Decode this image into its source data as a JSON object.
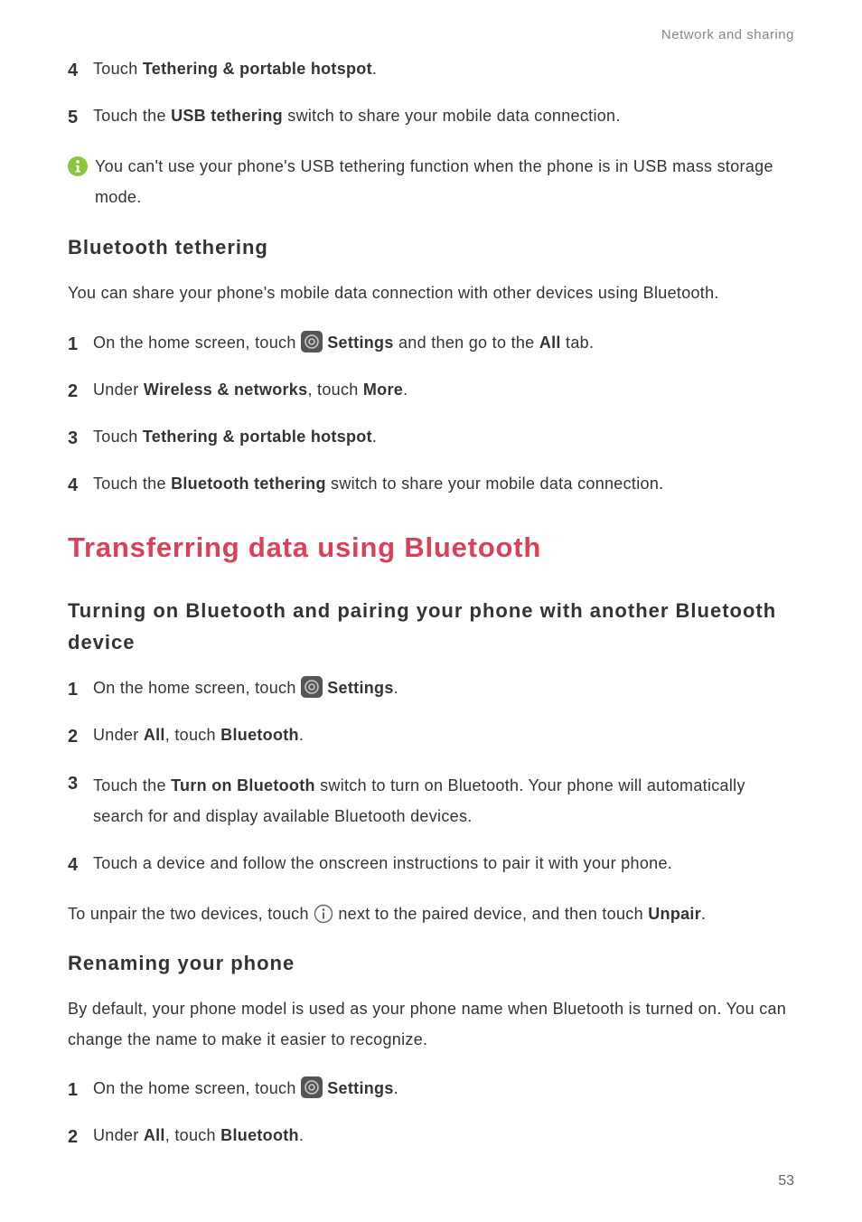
{
  "header": {
    "section": "Network and sharing"
  },
  "usb_steps": {
    "s4": {
      "pre": "Touch ",
      "bold": "Tethering & portable hotspot",
      "post": "."
    },
    "s5": {
      "pre": "Touch the ",
      "bold": "USB tethering",
      "post": " switch to share your mobile data connection."
    }
  },
  "info_note": "You can't use your phone's USB tethering function when the phone is in USB mass storage mode.",
  "bt_tether": {
    "title": "Bluetooth tethering",
    "intro": "You can share your phone's mobile data connection with other devices using Bluetooth.",
    "s1_pre": "On the home screen, touch ",
    "s1_settings": "Settings",
    "s1_mid": " and then go to the ",
    "s1_all": "All",
    "s1_post": " tab.",
    "s2_pre": "Under ",
    "s2_wifi": "Wireless & networks",
    "s2_mid": ", touch ",
    "s2_more": "More",
    "s2_post": ".",
    "s3_pre": "Touch ",
    "s3_bold": "Tethering & portable hotspot",
    "s3_post": ".",
    "s4_pre": "Touch the ",
    "s4_bold": "Bluetooth tethering",
    "s4_post": " switch to share your mobile data connection."
  },
  "transfer_bt": {
    "title": "Transferring data using Bluetooth"
  },
  "pairing": {
    "title": "Turning on Bluetooth and pairing your phone with another Bluetooth device",
    "s1_pre": "On the home screen, touch ",
    "s1_settings": "Settings",
    "s1_post": ".",
    "s2_pre": "Under ",
    "s2_all": "All",
    "s2_mid": ", touch ",
    "s2_bt": "Bluetooth",
    "s2_post": ".",
    "s3_pre": "Touch the ",
    "s3_bold": "Turn on Bluetooth",
    "s3_post": " switch to turn on Bluetooth. Your phone will automatically search for and display available Bluetooth devices.",
    "s4": "Touch a device and follow the onscreen instructions to pair it with your phone.",
    "unpair_pre": "To unpair the two devices, touch ",
    "unpair_mid": " next to the paired device, and then touch ",
    "unpair_bold": "Unpair",
    "unpair_post": "."
  },
  "rename": {
    "title": "Renaming your phone",
    "intro": "By default, your phone model is used as your phone name when Bluetooth is turned on. You can change the name to make it easier to recognize.",
    "s1_pre": "On the home screen, touch ",
    "s1_settings": "Settings",
    "s1_post": ".",
    "s2_pre": "Under ",
    "s2_all": "All",
    "s2_mid": ", touch ",
    "s2_bt": "Bluetooth",
    "s2_post": "."
  },
  "page_number": "53"
}
